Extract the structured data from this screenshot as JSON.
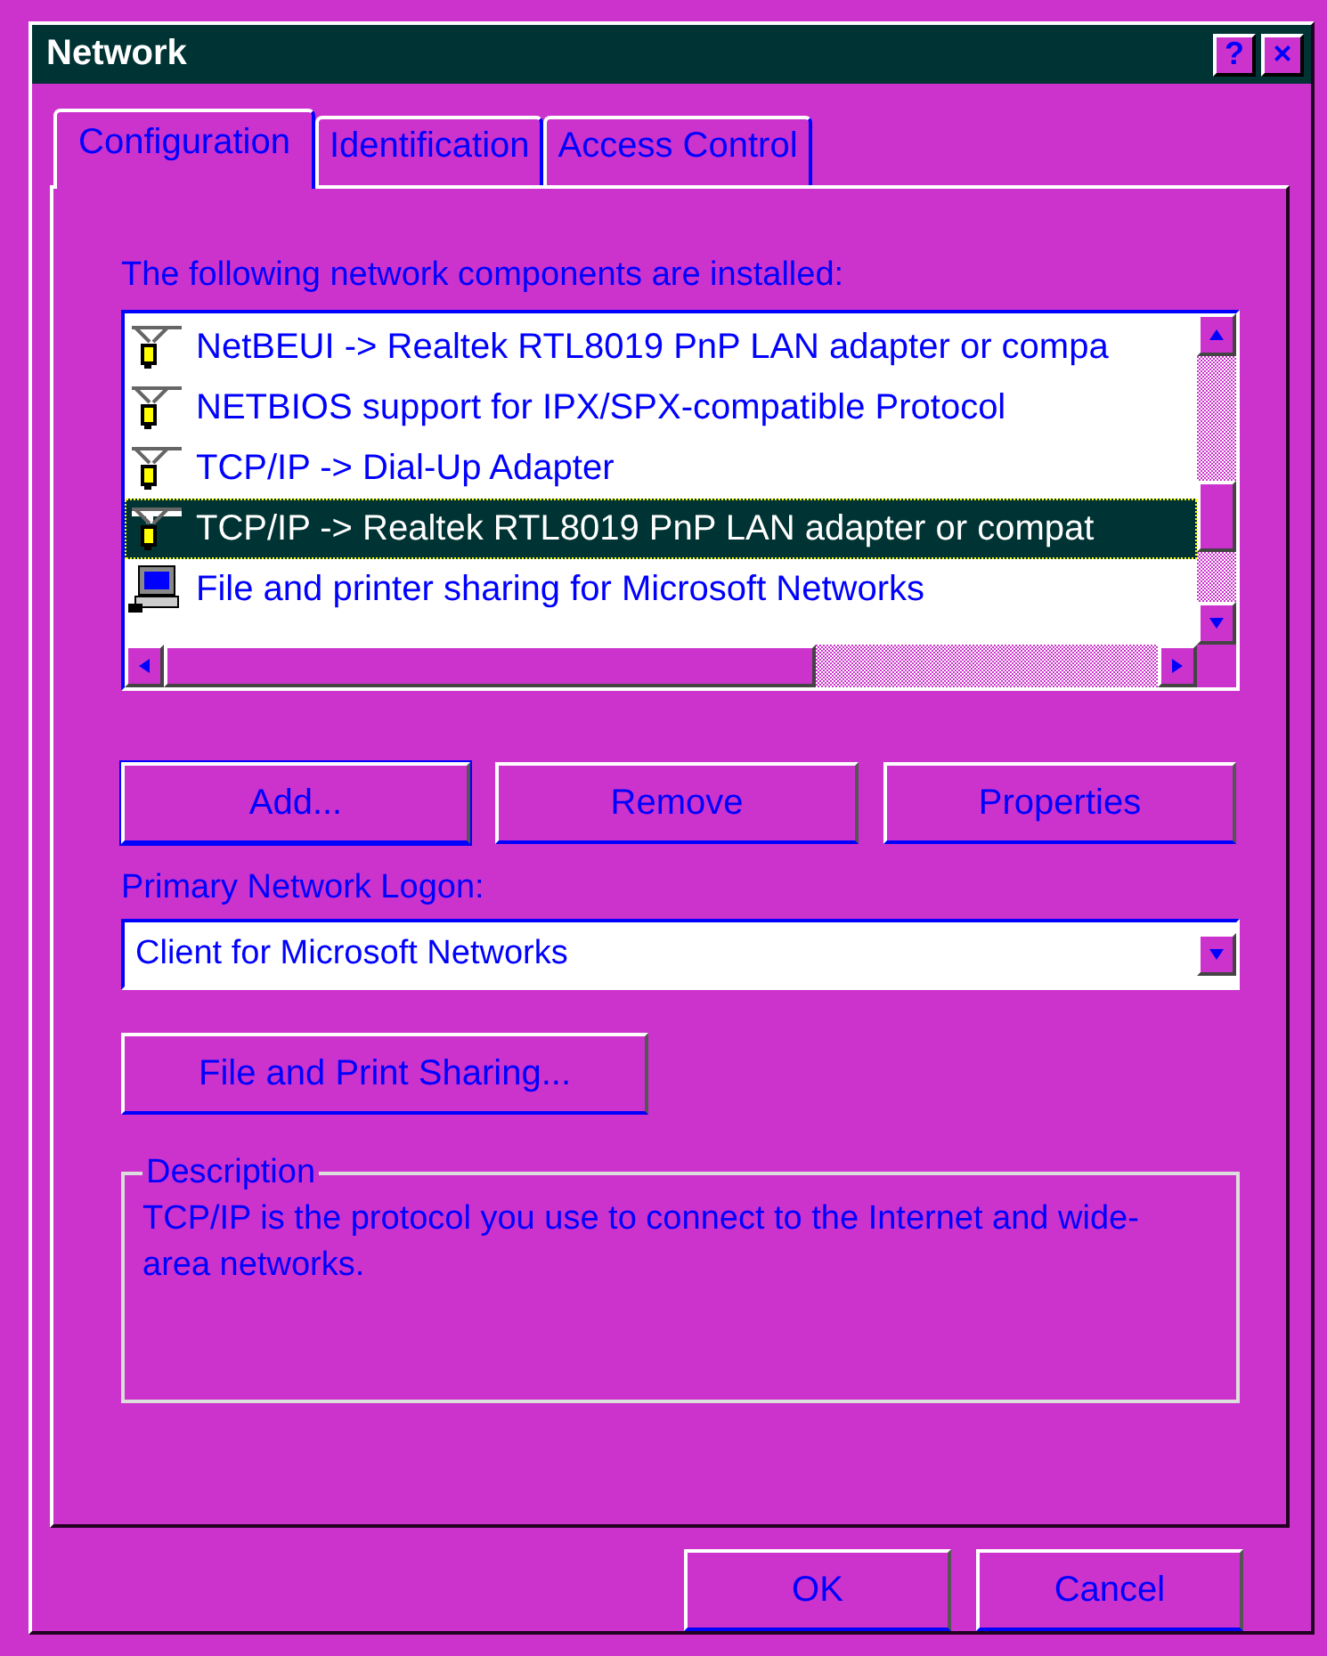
{
  "window": {
    "title": "Network",
    "help": "?",
    "close": "×"
  },
  "tabs": [
    {
      "label": "Configuration",
      "selected": true
    },
    {
      "label": "Identification",
      "selected": false
    },
    {
      "label": "Access Control",
      "selected": false
    }
  ],
  "components_label": "The following network components are installed:",
  "components": [
    {
      "kind": "protocol",
      "label": "NetBEUI -> Realtek RTL8019 PnP LAN adapter or compa",
      "selected": false
    },
    {
      "kind": "protocol",
      "label": "NETBIOS support for IPX/SPX-compatible Protocol",
      "selected": false
    },
    {
      "kind": "protocol",
      "label": "TCP/IP -> Dial-Up Adapter",
      "selected": false
    },
    {
      "kind": "protocol",
      "label": "TCP/IP -> Realtek RTL8019 PnP LAN adapter or compat",
      "selected": true
    },
    {
      "kind": "service",
      "label": "File and printer sharing for Microsoft Networks",
      "selected": false
    }
  ],
  "component_buttons": [
    "Add...",
    "Remove",
    "Properties"
  ],
  "logon": {
    "label": "Primary Network Logon:",
    "value": "Client for Microsoft Networks"
  },
  "sharing_button": "File and Print Sharing...",
  "description": {
    "title": "Description",
    "text": "TCP/IP is the protocol you use to connect to the Internet and wide-area networks."
  },
  "buttons": [
    "OK",
    "Cancel"
  ]
}
